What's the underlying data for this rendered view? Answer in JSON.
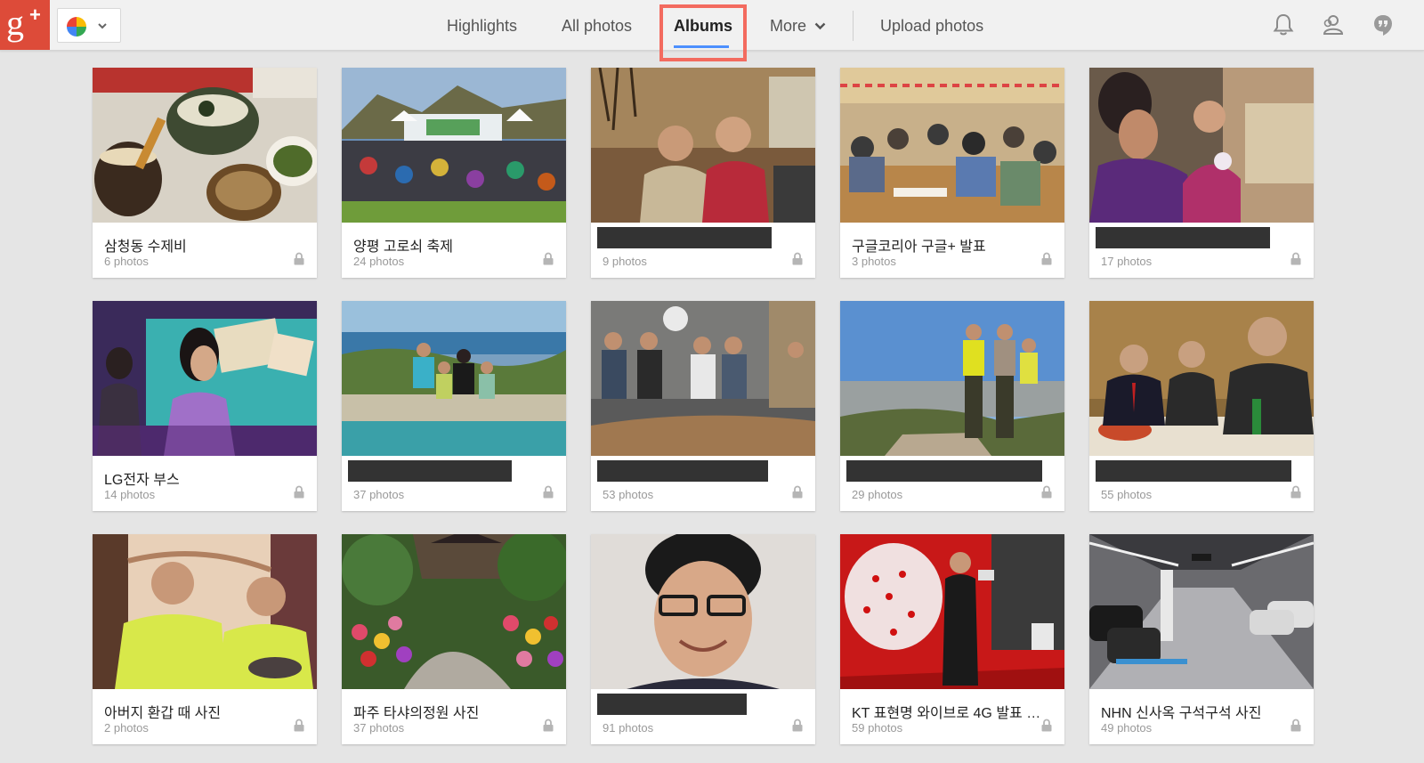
{
  "topbar": {
    "logo_letter": "g",
    "logo_plus": "+",
    "nav": {
      "highlights": "Highlights",
      "all_photos": "All photos",
      "albums": "Albums",
      "more": "More",
      "upload": "Upload photos"
    },
    "active_tab": "Albums"
  },
  "albums": [
    {
      "title": "삼청동 수제비",
      "count": "6 photos",
      "redacted": false,
      "visibility": "private"
    },
    {
      "title": "양평 고로쇠 축제",
      "count": "24 photos",
      "redacted": false,
      "visibility": "private"
    },
    {
      "title": "",
      "count": "9 photos",
      "redacted": true,
      "visibility": "private"
    },
    {
      "title": "구글코리아 구글+ 발표",
      "count": "3 photos",
      "redacted": false,
      "visibility": "private"
    },
    {
      "title": "",
      "count": "17 photos",
      "redacted": true,
      "visibility": "private"
    },
    {
      "title": "LG전자 부스",
      "count": "14 photos",
      "redacted": false,
      "visibility": "private"
    },
    {
      "title": "",
      "count": "37 photos",
      "redacted": true,
      "visibility": "private"
    },
    {
      "title": "",
      "count": "53 photos",
      "redacted": true,
      "visibility": "private"
    },
    {
      "title": "",
      "count": "29 photos",
      "redacted": true,
      "visibility": "private"
    },
    {
      "title": "",
      "count": "55 photos",
      "redacted": true,
      "visibility": "private"
    },
    {
      "title": "아버지 환갑 때 사진",
      "count": "2 photos",
      "redacted": false,
      "visibility": "private"
    },
    {
      "title": "파주 타샤의정원 사진",
      "count": "37 photos",
      "redacted": false,
      "visibility": "private"
    },
    {
      "title": "",
      "count": "91 photos",
      "redacted": true,
      "visibility": "private"
    },
    {
      "title": "KT 표현명 와이브로 4G 발표 기...",
      "count": "59 photos",
      "redacted": false,
      "visibility": "private"
    },
    {
      "title": "NHN 신사옥 구석구석 사진",
      "count": "49 photos",
      "redacted": false,
      "visibility": "private"
    }
  ],
  "colors": {
    "brand_red": "#dd4b39",
    "accent_blue": "#4d90fe",
    "highlight_box": "#f36b5f",
    "background": "#e5e5e5"
  },
  "icons": {
    "apps": "google-photos-pinwheel-icon",
    "notifications": "bell-icon",
    "share": "people-icon",
    "hangouts": "hangouts-icon",
    "lock": "lock-icon"
  }
}
